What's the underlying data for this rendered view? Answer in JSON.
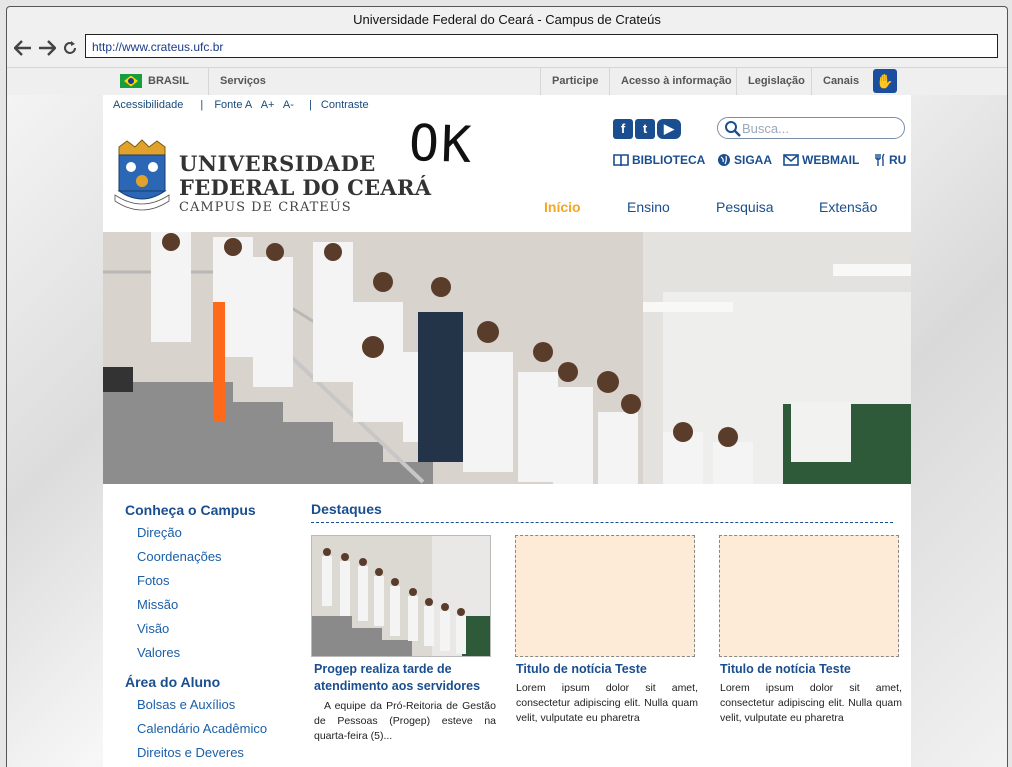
{
  "browser": {
    "title": "Universidade Federal do Ceará - Campus de Crateús",
    "url": "http://www.crateus.ufc.br"
  },
  "govbar": {
    "brasil": "BRASIL",
    "servicos": "Serviços",
    "participe": "Participe",
    "acesso": "Acesso à informação",
    "legislacao": "Legislação",
    "canais": "Canais"
  },
  "accessibility": {
    "acessibilidade": "Acessibilidade",
    "sep1": "|",
    "fonte": "Fonte A",
    "mais": "A+",
    "menos": "A-",
    "sep2": "|",
    "contraste": "Contraste"
  },
  "logo": {
    "line1": "UNIVERSIDADE",
    "line2": "FEDERAL DO CEARÁ",
    "line3": "CAMPUS DE CRATEÚS"
  },
  "annotation": "OK",
  "search": {
    "placeholder": "Busca..."
  },
  "quick_links": [
    "BIBLIOTECA",
    "SIGAA",
    "WEBMAIL",
    "RU"
  ],
  "nav": [
    "Início",
    "Ensino",
    "Pesquisa",
    "Extensão"
  ],
  "sidebar": {
    "section1": {
      "title": "Conheça o Campus",
      "items": [
        "Direção",
        "Coordenações",
        "Fotos",
        "Missão",
        "Visão",
        "Valores"
      ]
    },
    "section2": {
      "title": "Área do Aluno",
      "items": [
        "Bolsas e Auxílios",
        "Calendário Acadêmico",
        "Direitos e Deveres"
      ]
    }
  },
  "destaques": {
    "title": "Destaques",
    "cards": [
      {
        "title": "Progep realiza tarde de atendimento aos servidores",
        "text": "A equipe da Pró-Reitoria de Gestão de Pessoas (Progep) esteve na quarta-feira (5)..."
      },
      {
        "title": "Titulo de notícia Teste",
        "text": "Lorem ipsum dolor sit amet, consectetur adipiscing elit. Nulla quam velit, vulputate eu pharetra"
      },
      {
        "title": "Titulo de notícia Teste",
        "text": "Lorem ipsum dolor sit amet, consectetur adipiscing elit. Nulla quam velit, vulputate eu pharetra"
      }
    ]
  },
  "colors": {
    "brand_blue": "#1a4e8e",
    "active_nav": "#f5a623",
    "placeholder": "#fdebd8"
  }
}
